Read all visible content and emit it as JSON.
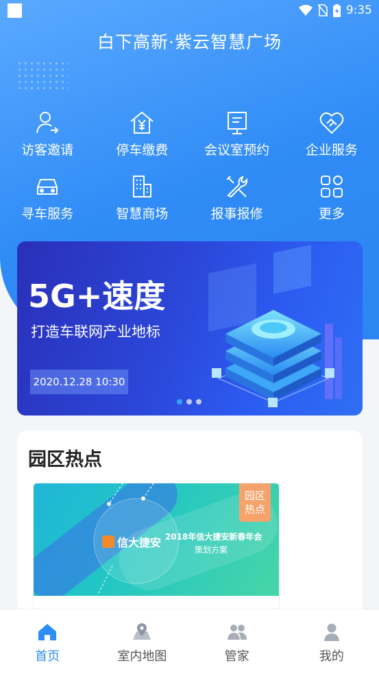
{
  "status_bar": {
    "time": "9:35"
  },
  "header": {
    "title": "白下高新·紫云智慧广场"
  },
  "services": [
    {
      "label": "访客邀请",
      "icon": "user-arrow-icon"
    },
    {
      "label": "停车缴费",
      "icon": "yen-house-icon"
    },
    {
      "label": "会议室预约",
      "icon": "board-icon"
    },
    {
      "label": "企业服务",
      "icon": "handshake-heart-icon"
    },
    {
      "label": "寻车服务",
      "icon": "car-icon"
    },
    {
      "label": "智慧商场",
      "icon": "building-icon"
    },
    {
      "label": "报事报修",
      "icon": "wrench-screwdriver-icon"
    },
    {
      "label": "更多",
      "icon": "grid-icon"
    }
  ],
  "banner": {
    "title": "5G+速度",
    "subtitle": "打造车联网产业地标",
    "date": "2020.12.28 10:30",
    "page_count": 3,
    "active_page": 1
  },
  "hot": {
    "title": "园区热点",
    "card": {
      "brand": "信大捷安",
      "headline": "2018年信大捷安新春年会",
      "subtitle": "策划方案",
      "tag_line1": "园区",
      "tag_line2": "热点"
    }
  },
  "tabbar": [
    {
      "label": "首页",
      "icon": "home-icon",
      "active": true
    },
    {
      "label": "室内地图",
      "icon": "map-pin-icon",
      "active": false
    },
    {
      "label": "管家",
      "icon": "people-icon",
      "active": false
    },
    {
      "label": "我的",
      "icon": "person-icon",
      "active": false
    }
  ],
  "colors": {
    "primary": "#2d8df5",
    "tag": "#f5a36a",
    "banner": "#2b47d9"
  }
}
